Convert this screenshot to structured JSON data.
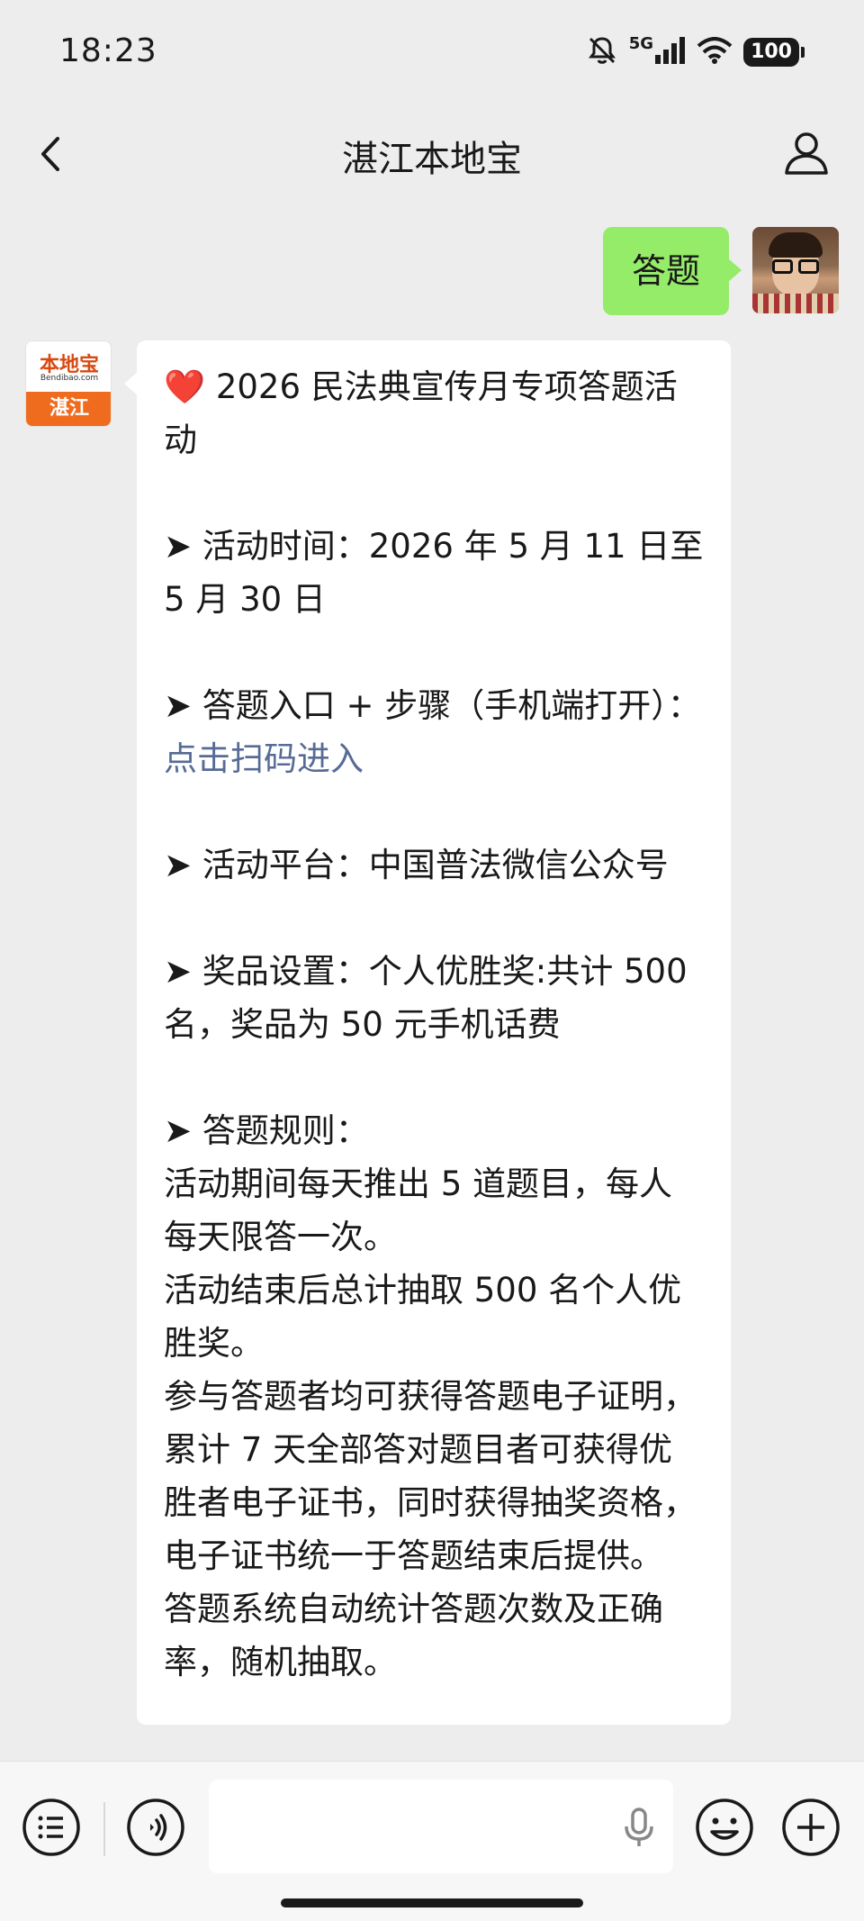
{
  "status": {
    "time": "18:23",
    "network": "5G",
    "battery": "100",
    "icons": [
      "mute-icon",
      "signal-icon",
      "wifi-icon",
      "battery-icon"
    ]
  },
  "nav": {
    "title": "湛江本地宝",
    "back_icon": "chevron-left-icon",
    "profile_icon": "person-icon"
  },
  "messages": {
    "user": {
      "text": "答题"
    },
    "bot": {
      "avatar_title": "本地宝",
      "avatar_subtitle": "Bendibao.com",
      "avatar_city": "湛江",
      "heart": "❤️",
      "title": " 2026 民法典宣传月专项答题活动",
      "time_line": "➤ 活动时间：2026 年 5 月 11 日至 5 月 30 日",
      "entry_prefix": "➤ 答题入口 + 步骤（手机端打开）：",
      "entry_link": "点击扫码进入",
      "platform_line": "➤ 活动平台：中国普法微信公众号",
      "prize_line": "➤ 奖品设置：个人优胜奖:共计 500 名，奖品为 50 元手机话费",
      "rules_heading": "➤ 答题规则：",
      "rules": [
        "活动期间每天推出 5 道题目，每人每天限答一次。",
        "活动结束后总计抽取 500 名个人优胜奖。",
        "参与答题者均可获得答题电子证明，累计 7 天全部答对题目者可获得优胜者电子证书，同时获得抽奖资格，电子证书统一于答题结束后提供。",
        "答题系统自动统计答题次数及正确率，随机抽取。"
      ]
    }
  },
  "input_bar": {
    "menu_icon": "menu-list-icon",
    "voice_icon": "voice-icon",
    "mic_icon": "microphone-icon",
    "emoji_icon": "emoji-icon",
    "plus_icon": "plus-icon",
    "placeholder": ""
  },
  "colors": {
    "background": "#ededed",
    "user_bubble": "#95ec69",
    "bot_bubble": "#ffffff",
    "link": "#576b95",
    "brand_orange": "#ef6c1f"
  }
}
